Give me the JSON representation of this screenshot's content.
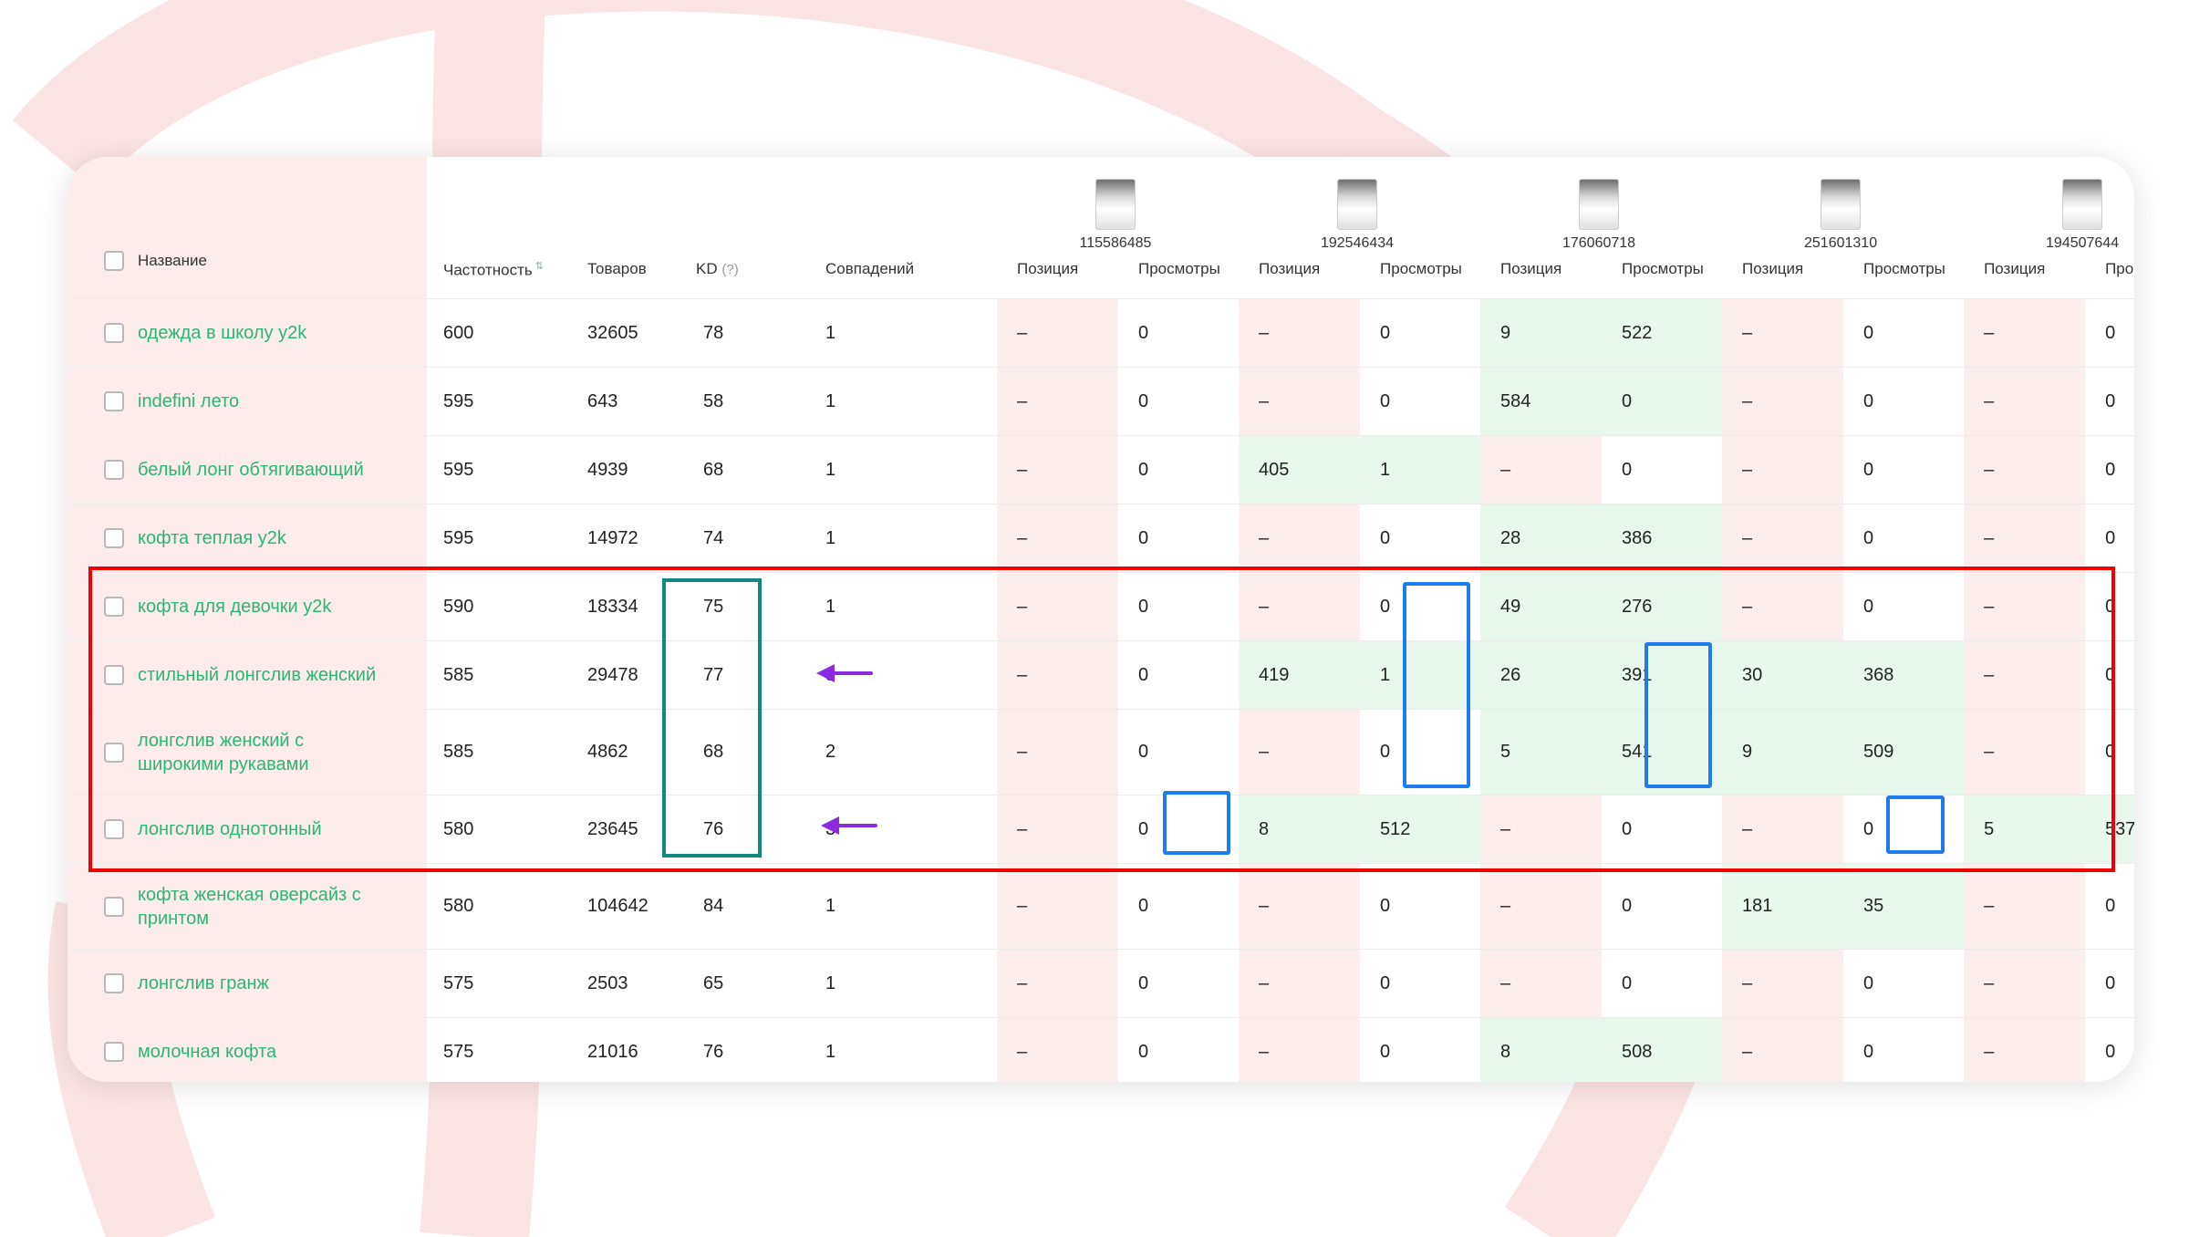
{
  "header": {
    "name": "Название",
    "frequency": "Частотность",
    "products": "Товаров",
    "kd": "KD",
    "kd_hint": "(?)",
    "matches": "Совпадений",
    "position": "Позиция",
    "views": "Просмотры"
  },
  "product_ids": [
    "115586485",
    "192546434",
    "176060718",
    "251601310",
    "194507644"
  ],
  "rows": [
    {
      "name": "одежда в школу y2k",
      "freq": "600",
      "goods": "32605",
      "kd": "78",
      "match": "1",
      "cells": [
        [
          "–",
          "0"
        ],
        [
          "–",
          "0"
        ],
        [
          "9",
          "522"
        ],
        [
          "–",
          "0"
        ],
        [
          "–",
          "0"
        ]
      ]
    },
    {
      "name": "indefini лето",
      "freq": "595",
      "goods": "643",
      "kd": "58",
      "match": "1",
      "cells": [
        [
          "–",
          "0"
        ],
        [
          "–",
          "0"
        ],
        [
          "584",
          "0"
        ],
        [
          "–",
          "0"
        ],
        [
          "–",
          "0"
        ]
      ]
    },
    {
      "name": "белый лонг обтягивающий",
      "freq": "595",
      "goods": "4939",
      "kd": "68",
      "match": "1",
      "cells": [
        [
          "–",
          "0"
        ],
        [
          "405",
          "1"
        ],
        [
          "–",
          "0"
        ],
        [
          "–",
          "0"
        ],
        [
          "–",
          "0"
        ]
      ]
    },
    {
      "name": "кофта теплая y2k",
      "freq": "595",
      "goods": "14972",
      "kd": "74",
      "match": "1",
      "cells": [
        [
          "–",
          "0"
        ],
        [
          "–",
          "0"
        ],
        [
          "28",
          "386"
        ],
        [
          "–",
          "0"
        ],
        [
          "–",
          "0"
        ]
      ]
    },
    {
      "name": "кофта для девочки y2k",
      "freq": "590",
      "goods": "18334",
      "kd": "75",
      "match": "1",
      "cells": [
        [
          "–",
          "0"
        ],
        [
          "–",
          "0"
        ],
        [
          "49",
          "276"
        ],
        [
          "–",
          "0"
        ],
        [
          "–",
          "0"
        ]
      ]
    },
    {
      "name": "стильный лонгслив женский",
      "freq": "585",
      "goods": "29478",
      "kd": "77",
      "match": "3",
      "cells": [
        [
          "–",
          "0"
        ],
        [
          "419",
          "1"
        ],
        [
          "26",
          "391"
        ],
        [
          "30",
          "368"
        ],
        [
          "–",
          "0"
        ]
      ]
    },
    {
      "name": "лонгслив женский с широкими рукавами",
      "freq": "585",
      "goods": "4862",
      "kd": "68",
      "match": "2",
      "cells": [
        [
          "–",
          "0"
        ],
        [
          "–",
          "0"
        ],
        [
          "5",
          "541"
        ],
        [
          "9",
          "509"
        ],
        [
          "–",
          "0"
        ]
      ]
    },
    {
      "name": "лонгслив однотонный",
      "freq": "580",
      "goods": "23645",
      "kd": "76",
      "match": "3",
      "cells": [
        [
          "–",
          "0"
        ],
        [
          "8",
          "512"
        ],
        [
          "–",
          "0"
        ],
        [
          "–",
          "0"
        ],
        [
          "5",
          "537"
        ]
      ]
    },
    {
      "name": "кофта женская оверсайз с принтом",
      "freq": "580",
      "goods": "104642",
      "kd": "84",
      "match": "1",
      "cells": [
        [
          "–",
          "0"
        ],
        [
          "–",
          "0"
        ],
        [
          "–",
          "0"
        ],
        [
          "181",
          "35"
        ],
        [
          "–",
          "0"
        ]
      ]
    },
    {
      "name": "лонгслив гранж",
      "freq": "575",
      "goods": "2503",
      "kd": "65",
      "match": "1",
      "cells": [
        [
          "–",
          "0"
        ],
        [
          "–",
          "0"
        ],
        [
          "–",
          "0"
        ],
        [
          "–",
          "0"
        ],
        [
          "–",
          "0"
        ]
      ]
    },
    {
      "name": "молочная кофта",
      "freq": "575",
      "goods": "21016",
      "kd": "76",
      "match": "1",
      "cells": [
        [
          "–",
          "0"
        ],
        [
          "–",
          "0"
        ],
        [
          "8",
          "508"
        ],
        [
          "–",
          "0"
        ],
        [
          "–",
          "0"
        ]
      ]
    }
  ],
  "colors": {
    "name_text": "#2bb673",
    "negative_cell": "#fdeeee",
    "positive_cell": "#e9f8ec",
    "highlight_red": "#f00000",
    "highlight_teal": "#0f8a7c",
    "highlight_blue": "#1c7cf0",
    "arrow": "#8a2be2"
  }
}
